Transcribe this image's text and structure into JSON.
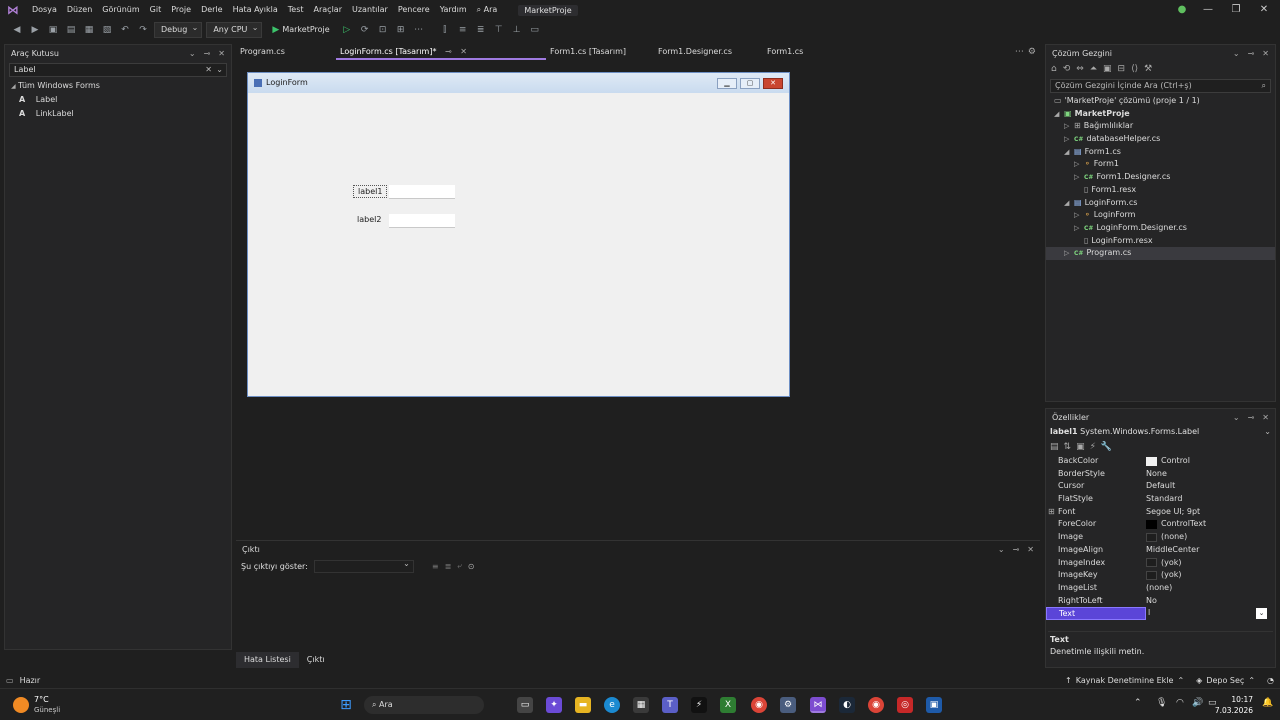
{
  "menu": {
    "items": [
      "Dosya",
      "Düzen",
      "Görünüm",
      "Git",
      "Proje",
      "Derle",
      "Hata Ayıkla",
      "Test",
      "Araçlar",
      "Uzantılar",
      "Pencere",
      "Yardım"
    ],
    "search_label": "Ara",
    "app_title": "MarketProje"
  },
  "toolbar": {
    "config": "Debug",
    "platform": "Any CPU",
    "start_label": "MarketProje"
  },
  "toolbox": {
    "title": "Araç Kutusu",
    "search_value": "Label",
    "group": "Tüm Windows Forms",
    "items": [
      "Label",
      "LinkLabel"
    ]
  },
  "doc_tabs": [
    "Program.cs",
    "LoginForm.cs [Tasarım]*",
    "Form1.cs [Tasarım]",
    "Form1.Designer.cs",
    "Form1.cs"
  ],
  "form": {
    "title": "LoginForm",
    "label1": "label1",
    "label2": "label2"
  },
  "output": {
    "title": "Çıktı",
    "show_label": "Şu çıktıyı göster:"
  },
  "bottom_tabs": [
    "Hata Listesi",
    "Çıktı"
  ],
  "solution": {
    "title": "Çözüm Gezgini",
    "search_placeholder": "Çözüm Gezgini İçinde Ara (Ctrl+ş)",
    "rows": [
      "'MarketProje' çözümü (proje 1 / 1)",
      "MarketProje",
      "Bağımlılıklar",
      "databaseHelper.cs",
      "Form1.cs",
      "Form1",
      "Form1.Designer.cs",
      "Form1.resx",
      "LoginForm.cs",
      "LoginForm",
      "LoginForm.Designer.cs",
      "LoginForm.resx",
      "Program.cs"
    ]
  },
  "properties": {
    "title": "Özellikler",
    "object": "label1",
    "object_type": "System.Windows.Forms.Label",
    "rows": [
      {
        "name": "BackColor",
        "value": "Control",
        "swatch": "#f0f0f0"
      },
      {
        "name": "BorderStyle",
        "value": "None"
      },
      {
        "name": "Cursor",
        "value": "Default"
      },
      {
        "name": "FlatStyle",
        "value": "Standard"
      },
      {
        "name": "Font",
        "value": "Segoe UI; 9pt"
      },
      {
        "name": "ForeColor",
        "value": "ControlText",
        "swatch": "#000000"
      },
      {
        "name": "Image",
        "value": "(none)",
        "swatch": "#252526"
      },
      {
        "name": "ImageAlign",
        "value": "MiddleCenter"
      },
      {
        "name": "ImageIndex",
        "value": "(yok)",
        "swatch": "#252526"
      },
      {
        "name": "ImageKey",
        "value": "(yok)",
        "swatch": "#252526"
      },
      {
        "name": "ImageList",
        "value": "(none)"
      },
      {
        "name": "RightToLeft",
        "value": "No"
      },
      {
        "name": "Text",
        "value": "l"
      }
    ],
    "desc_title": "Text",
    "desc_text": "Denetimle ilişkili metin."
  },
  "status": {
    "left": "Hazır",
    "source_control": "Kaynak Denetimine Ekle",
    "repo": "Depo Seç"
  },
  "taskbar": {
    "temp": "7°C",
    "weather": "Güneşli",
    "search": "Ara",
    "time": "10:17",
    "date": "7.03.2026"
  }
}
